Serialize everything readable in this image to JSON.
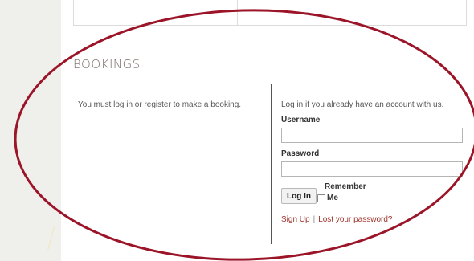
{
  "section": {
    "heading": "BOOKINGS"
  },
  "booking": {
    "message": "You must log in or register to make a booking."
  },
  "login": {
    "intro": "Log in if you already have an account with us.",
    "username_label": "Username",
    "username_value": "",
    "password_label": "Password",
    "password_value": "",
    "remember_label": "Remember",
    "remember_me": "Me",
    "login_button": "Log In",
    "signup_link": "Sign Up",
    "separator": "|",
    "lost_password_link": "Lost your password?"
  },
  "colors": {
    "annotation_ellipse": "#9b1428",
    "link": "#a0332c",
    "heading": "#7a6a66"
  }
}
